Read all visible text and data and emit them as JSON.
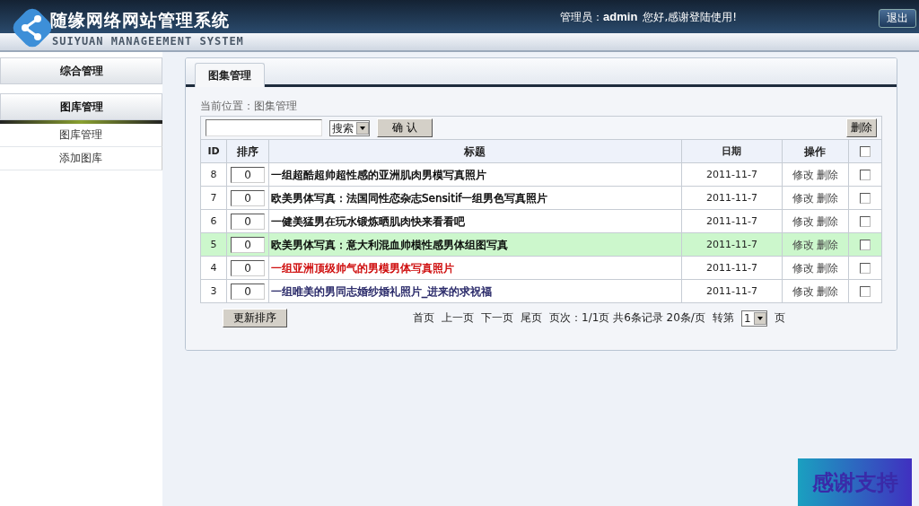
{
  "header": {
    "title": "随缘网络网站管理系统",
    "subtitle": "SUIYUAN MANAGEEMENT SYSTEM",
    "greeting_label": "管理员：",
    "user": "admin",
    "greeting": "您好,感谢登陆使用!",
    "logout": "退出"
  },
  "sidebar": [
    {
      "label": "综合管理",
      "expanded": false
    },
    {
      "label": "图库管理",
      "expanded": true,
      "children": [
        {
          "label": "图库管理"
        },
        {
          "label": "添加图库"
        }
      ]
    }
  ],
  "tab": {
    "label": "图集管理"
  },
  "breadcrumb": "当前位置：图集管理",
  "search": {
    "select": "搜索",
    "confirm": "确 认",
    "delete": "删除"
  },
  "table": {
    "columns": [
      "ID",
      "排序",
      "标题",
      "日期",
      "操作"
    ],
    "rows": [
      {
        "id": "8",
        "order": "0",
        "title": "一组超酷超帅超性感的亚洲肌肉男模写真照片",
        "date": "2011-11-7",
        "edit": "修改",
        "delete": "删除",
        "checked": false,
        "selected": false,
        "color": "#000000"
      },
      {
        "id": "7",
        "order": "0",
        "title": "欧美男体写真：法国同性恋杂志Sensitif一组男色写真照片",
        "date": "2011-11-7",
        "edit": "修改",
        "delete": "删除",
        "checked": false,
        "selected": false,
        "color": "#000000"
      },
      {
        "id": "6",
        "order": "0",
        "title": "一健美猛男在玩水锻炼晒肌肉快来看看吧",
        "date": "2011-11-7",
        "edit": "修改",
        "delete": "删除",
        "checked": false,
        "selected": false,
        "color": "#000000"
      },
      {
        "id": "5",
        "order": "0",
        "title": "欧美男体写真：意大利混血帅模性感男体组图写真",
        "date": "2011-11-7",
        "edit": "修改",
        "delete": "删除",
        "checked": false,
        "selected": true,
        "color": "#000000"
      },
      {
        "id": "4",
        "order": "0",
        "title": "一组亚洲顶级帅气的男模男体写真照片",
        "date": "2011-11-7",
        "edit": "修改",
        "delete": "删除",
        "checked": false,
        "selected": false,
        "color": "#cc0000"
      },
      {
        "id": "3",
        "order": "0",
        "title": "一组唯美的男同志婚纱婚礼照片_进来的求祝福",
        "date": "2011-11-7",
        "edit": "修改",
        "delete": "删除",
        "checked": false,
        "selected": false,
        "color": "#1a1a5e"
      }
    ],
    "all_checked": false
  },
  "update_order": "更新排序",
  "pager": {
    "links": [
      "首页",
      "上一页",
      "下一页",
      "尾页"
    ],
    "info": "页次：1/1页 共6条记录 20条/页",
    "goto": "转第",
    "page": "1",
    "page_suffix": "页"
  },
  "thanks": "感谢支持"
}
